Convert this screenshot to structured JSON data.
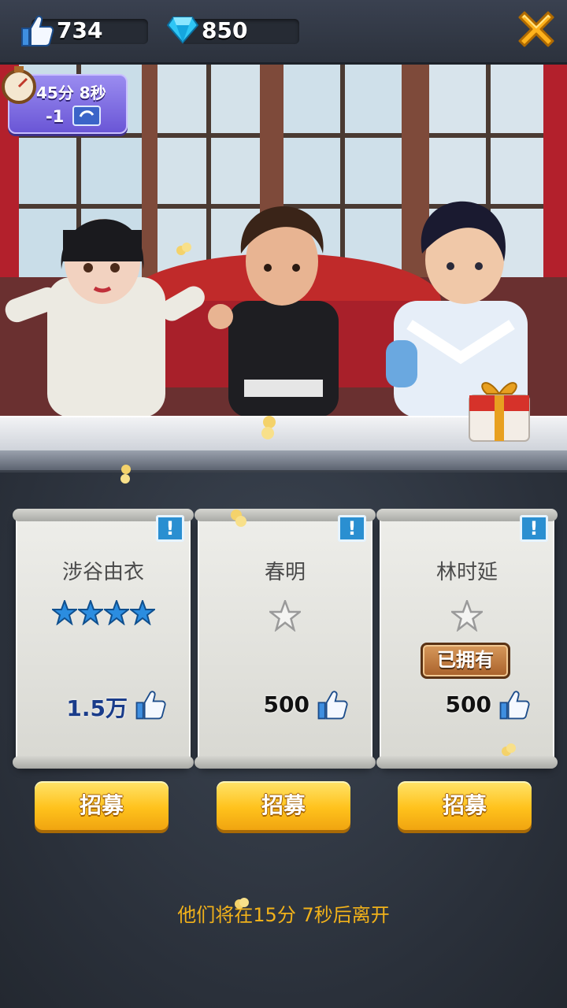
{
  "topbar": {
    "likes": "734",
    "gems": "850",
    "like_icon": "thumbs-up-icon",
    "gem_icon": "diamond-icon",
    "close_icon": "close-icon"
  },
  "timer": {
    "time": "45分 8秒",
    "cost": "-1",
    "icon": "stopwatch-icon"
  },
  "cards": [
    {
      "name": "涉谷由衣",
      "stars_filled": 4,
      "stars_total": 4,
      "cost": "1.5万",
      "owned": false,
      "button": "招募"
    },
    {
      "name": "春明",
      "stars_filled": 0,
      "stars_total": 1,
      "cost": "500",
      "owned": false,
      "button": "招募"
    },
    {
      "name": "林时延",
      "stars_filled": 0,
      "stars_total": 1,
      "cost": "500",
      "owned": true,
      "owned_label": "已拥有",
      "button": "招募"
    }
  ],
  "info_badge": "!",
  "footer": {
    "leave_text": "他们将在15分 7秒后离开"
  },
  "colors": {
    "accent_button": "#ffc21c",
    "timer_bg": "#6a56d6",
    "leave_text": "#f2b21a"
  }
}
